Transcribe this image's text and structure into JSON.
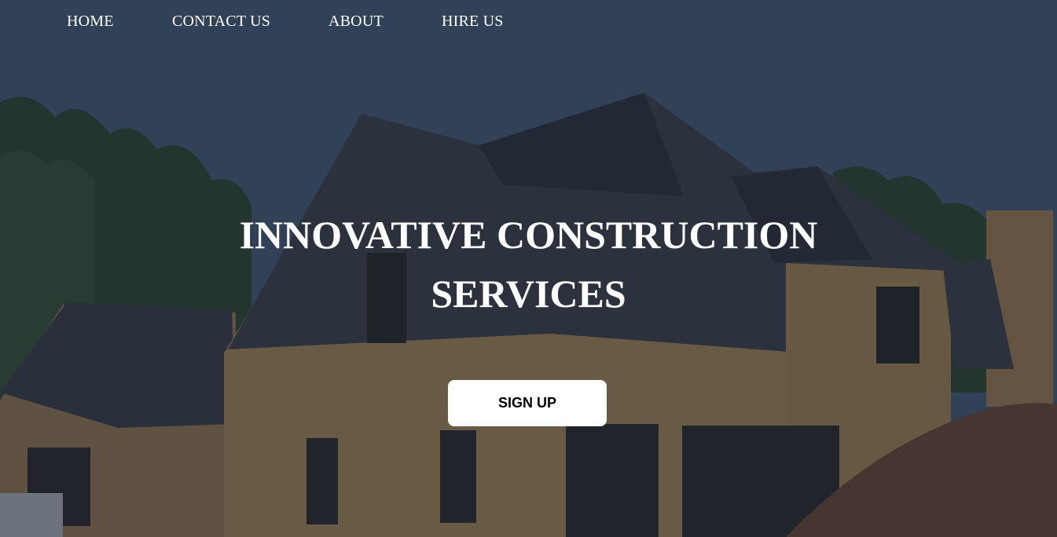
{
  "nav": {
    "items": [
      {
        "label": "HOME"
      },
      {
        "label": "CONTACT US"
      },
      {
        "label": "ABOUT"
      },
      {
        "label": "HIRE US"
      }
    ]
  },
  "hero": {
    "background_image": "house-under-construction",
    "headline": "INNOVATIVE CONSTRUCTION SERVICES",
    "cta_label": "SIGN UP"
  },
  "colors": {
    "overlay": "#1c2434",
    "text": "#ffffff",
    "button_bg": "#ffffff",
    "button_text": "#000000"
  }
}
